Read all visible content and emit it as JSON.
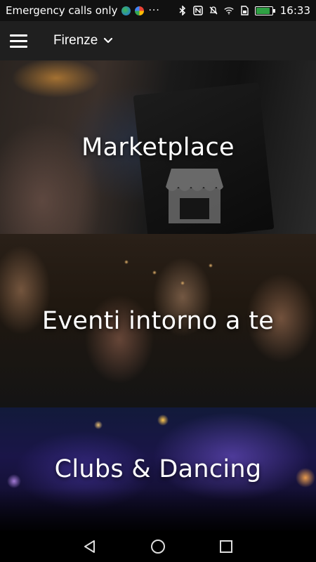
{
  "status_bar": {
    "carrier": "Emergency calls only",
    "more": "···",
    "time": "16:33",
    "battery_level": 0.9,
    "icons": [
      "bluetooth-icon",
      "nfc-icon",
      "mute-icon",
      "wifi-icon",
      "sim-icon",
      "battery-icon"
    ]
  },
  "app_bar": {
    "city": "Firenze"
  },
  "tiles": [
    {
      "label": "Marketplace"
    },
    {
      "label": "Eventi intorno a te"
    },
    {
      "label": "Clubs & Dancing"
    }
  ],
  "colors": {
    "status_bar_bg": "#111111",
    "app_bar_bg": "#1f1f1f",
    "battery_fill": "#2ea043"
  }
}
